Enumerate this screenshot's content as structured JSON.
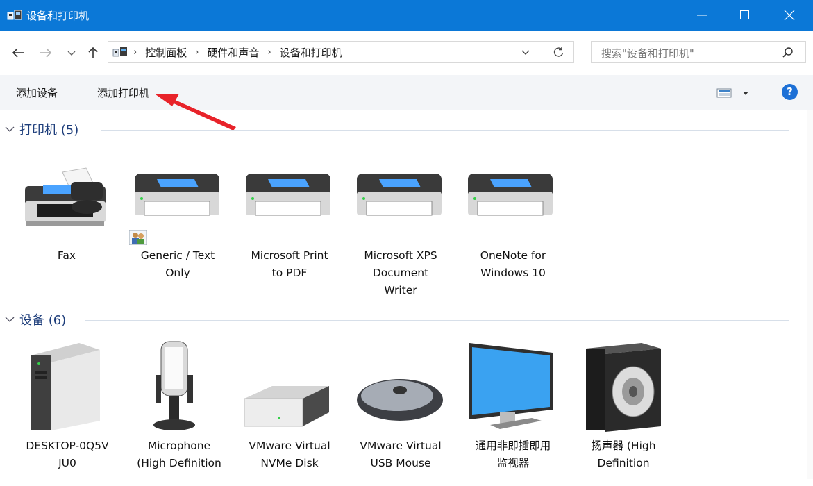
{
  "window": {
    "title": "设备和打印机",
    "controls": {
      "minimize": "minimize-icon",
      "maximize": "maximize-icon",
      "close": "close-icon"
    }
  },
  "nav": {
    "back": "back-arrow-icon",
    "forward": "forward-arrow-icon",
    "recent": "chevron-down-icon",
    "up": "up-arrow-icon",
    "breadcrumbs": [
      "控制面板",
      "硬件和声音",
      "设备和打印机"
    ],
    "refresh": "refresh-icon"
  },
  "search": {
    "placeholder": "搜索\"设备和打印机\""
  },
  "toolbar": {
    "add_device": "添加设备",
    "add_printer": "添加打印机",
    "help": "?"
  },
  "sections": {
    "printers": {
      "title": "打印机 (5)",
      "items": [
        {
          "line1": "Fax",
          "line2": "",
          "line3": ""
        },
        {
          "line1": "Generic / Text",
          "line2": "Only",
          "line3": ""
        },
        {
          "line1": "Microsoft Print",
          "line2": "to PDF",
          "line3": ""
        },
        {
          "line1": "Microsoft XPS",
          "line2": "Document",
          "line3": "Writer"
        },
        {
          "line1": "OneNote for",
          "line2": "Windows 10",
          "line3": ""
        }
      ]
    },
    "devices": {
      "title": "设备 (6)",
      "items": [
        {
          "line1": "DESKTOP-0Q5V",
          "line2": "JU0"
        },
        {
          "line1": "Microphone",
          "line2": "(High Definition"
        },
        {
          "line1": "VMware Virtual",
          "line2": "NVMe Disk"
        },
        {
          "line1": "VMware Virtual",
          "line2": "USB Mouse"
        },
        {
          "line1": "通用非即插即用",
          "line2": "监视器"
        },
        {
          "line1": "扬声器 (High",
          "line2": "Definition"
        }
      ]
    }
  },
  "colors": {
    "titlebar": "#0b78d7",
    "section_title": "#1e3e7b",
    "annotation_arrow": "#e8232a"
  }
}
